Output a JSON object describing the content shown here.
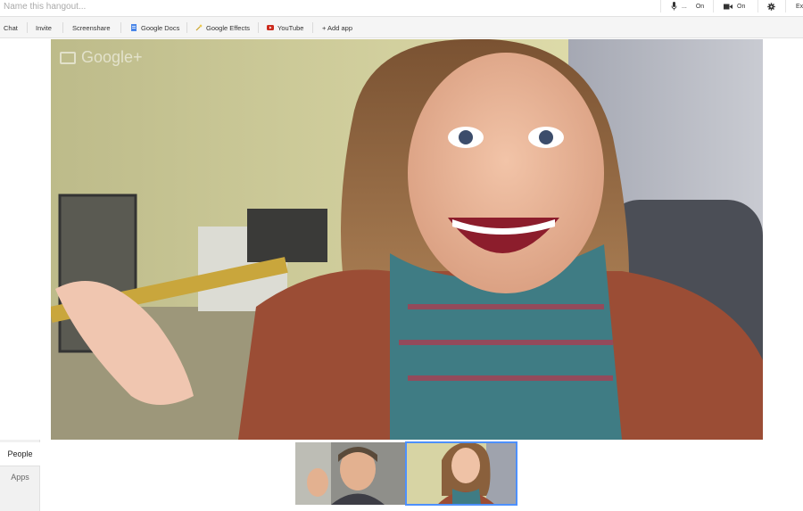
{
  "topbar": {
    "title_placeholder": "Name this hangout...",
    "mic": {
      "icon": "microphone-icon",
      "label": "...",
      "value": "On"
    },
    "camera": {
      "icon": "video-camera-icon",
      "value": "On"
    },
    "settings": {
      "icon": "gear-icon"
    },
    "exit": {
      "label": "Ex"
    }
  },
  "toolbar": {
    "chat": "Chat",
    "invite": "Invite",
    "screenshare": "Screenshare",
    "google_docs": "Google Docs",
    "google_effects": "Google Effects",
    "youtube": "YouTube",
    "add_app": "+ Add app"
  },
  "video": {
    "logo_text": "Google+",
    "accent": "#4d90fe"
  },
  "sidebar": {
    "tabs": [
      {
        "label": "People",
        "active": true
      },
      {
        "label": "Apps",
        "active": false
      }
    ]
  },
  "participants": [
    {
      "name": "participant-1",
      "selected": false
    },
    {
      "name": "participant-2",
      "selected": true
    }
  ]
}
